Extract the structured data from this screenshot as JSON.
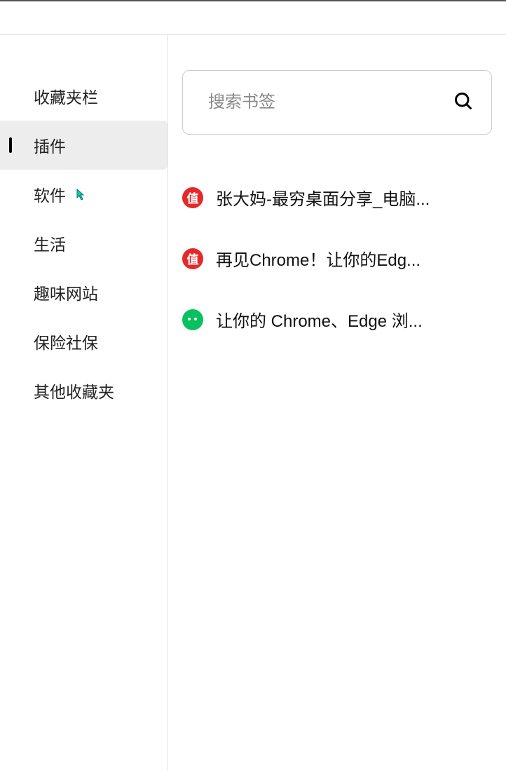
{
  "sidebar": {
    "items": [
      {
        "label": "收藏夹栏"
      },
      {
        "label": "插件"
      },
      {
        "label": "软件"
      },
      {
        "label": "生活"
      },
      {
        "label": "趣味网站"
      },
      {
        "label": "保险社保"
      },
      {
        "label": "其他收藏夹"
      }
    ]
  },
  "search": {
    "placeholder": "搜索书签"
  },
  "bookmarks": [
    {
      "icon_type": "zhi",
      "icon_text": "值",
      "title": "张大妈-最穷桌面分享_电脑..."
    },
    {
      "icon_type": "zhi",
      "icon_text": "值",
      "title": "再见Chrome！让你的Edg..."
    },
    {
      "icon_type": "wechat",
      "icon_text": "",
      "title": "让你的 Chrome、Edge 浏..."
    }
  ]
}
